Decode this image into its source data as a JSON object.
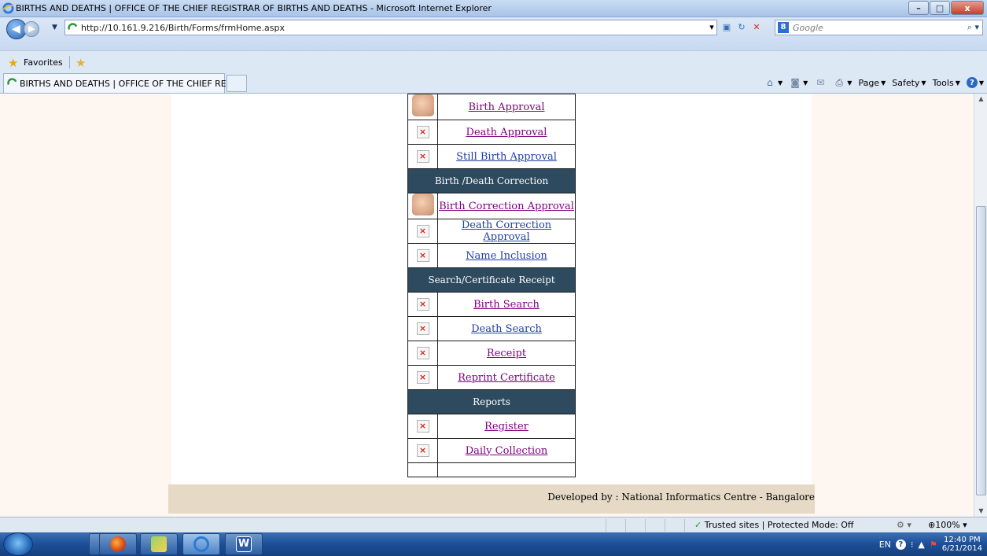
{
  "window": {
    "title": "BIRTHS AND DEATHS | OFFICE OF THE CHIEF REGISTRAR OF BIRTHS AND DEATHS - Microsoft Internet Explorer",
    "minimize_glyph": "–",
    "maximize_glyph": "□",
    "close_glyph": "x"
  },
  "address_bar": {
    "url": "http://10.161.9.216/Birth/Forms/frmHome.aspx"
  },
  "search_box": {
    "placeholder": "Google",
    "provider_letter": "8"
  },
  "favorites_bar": {
    "label": "Favorites"
  },
  "tabs": [
    {
      "label": "BIRTHS AND DEATHS | OFFICE OF THE CHIEF RE..."
    }
  ],
  "command_bar": {
    "page": "Page",
    "safety": "Safety",
    "tools": "Tools"
  },
  "menu": {
    "rows": [
      {
        "type": "link",
        "icon": "baby-photo-icon",
        "label": "Birth Approval",
        "visited": true
      },
      {
        "type": "link",
        "icon": "broken-image-icon",
        "label": "Death Approval",
        "visited": true
      },
      {
        "type": "link",
        "icon": "broken-image-icon",
        "label": "Still Birth Approval",
        "visited": false
      },
      {
        "type": "section",
        "label": "Birth /Death Correction"
      },
      {
        "type": "link",
        "icon": "baby-photo-icon",
        "label": "Birth Correction Approval",
        "visited": true
      },
      {
        "type": "link",
        "icon": "broken-image-icon",
        "label": "Death Correction Approval",
        "visited": false
      },
      {
        "type": "link",
        "icon": "broken-image-icon",
        "label": "Name Inclusion",
        "visited": false
      },
      {
        "type": "section",
        "label": "Search/Certificate Receipt"
      },
      {
        "type": "link",
        "icon": "broken-image-icon",
        "label": "Birth Search",
        "visited": true
      },
      {
        "type": "link",
        "icon": "broken-image-icon",
        "label": "Death Search",
        "visited": false
      },
      {
        "type": "link",
        "icon": "broken-image-icon",
        "label": "Receipt",
        "visited": true
      },
      {
        "type": "link",
        "icon": "broken-image-icon",
        "label": "Reprint Certificate",
        "visited": true
      },
      {
        "type": "section",
        "label": "Reports"
      },
      {
        "type": "link",
        "icon": "broken-image-icon",
        "label": "Register",
        "visited": true
      },
      {
        "type": "link",
        "icon": "broken-image-icon",
        "label": "Daily Collection",
        "visited": true
      }
    ],
    "broken_image_glyph": "×"
  },
  "footer": {
    "text": "Developed by : National Informatics Centre - Bangalore"
  },
  "status_bar": {
    "zone": "Trusted sites | Protected Mode: Off",
    "zoom": "100%"
  },
  "taskbar": {
    "language": "EN",
    "time": "12:40 PM",
    "date": "6/21/2014"
  },
  "colors": {
    "section_header_bg": "#2d4a5f",
    "visited_link": "#800080",
    "unvisited_link": "#1e3fa8",
    "footer_bg": "#e6d9c5",
    "viewport_bg": "#fdf6f1"
  }
}
